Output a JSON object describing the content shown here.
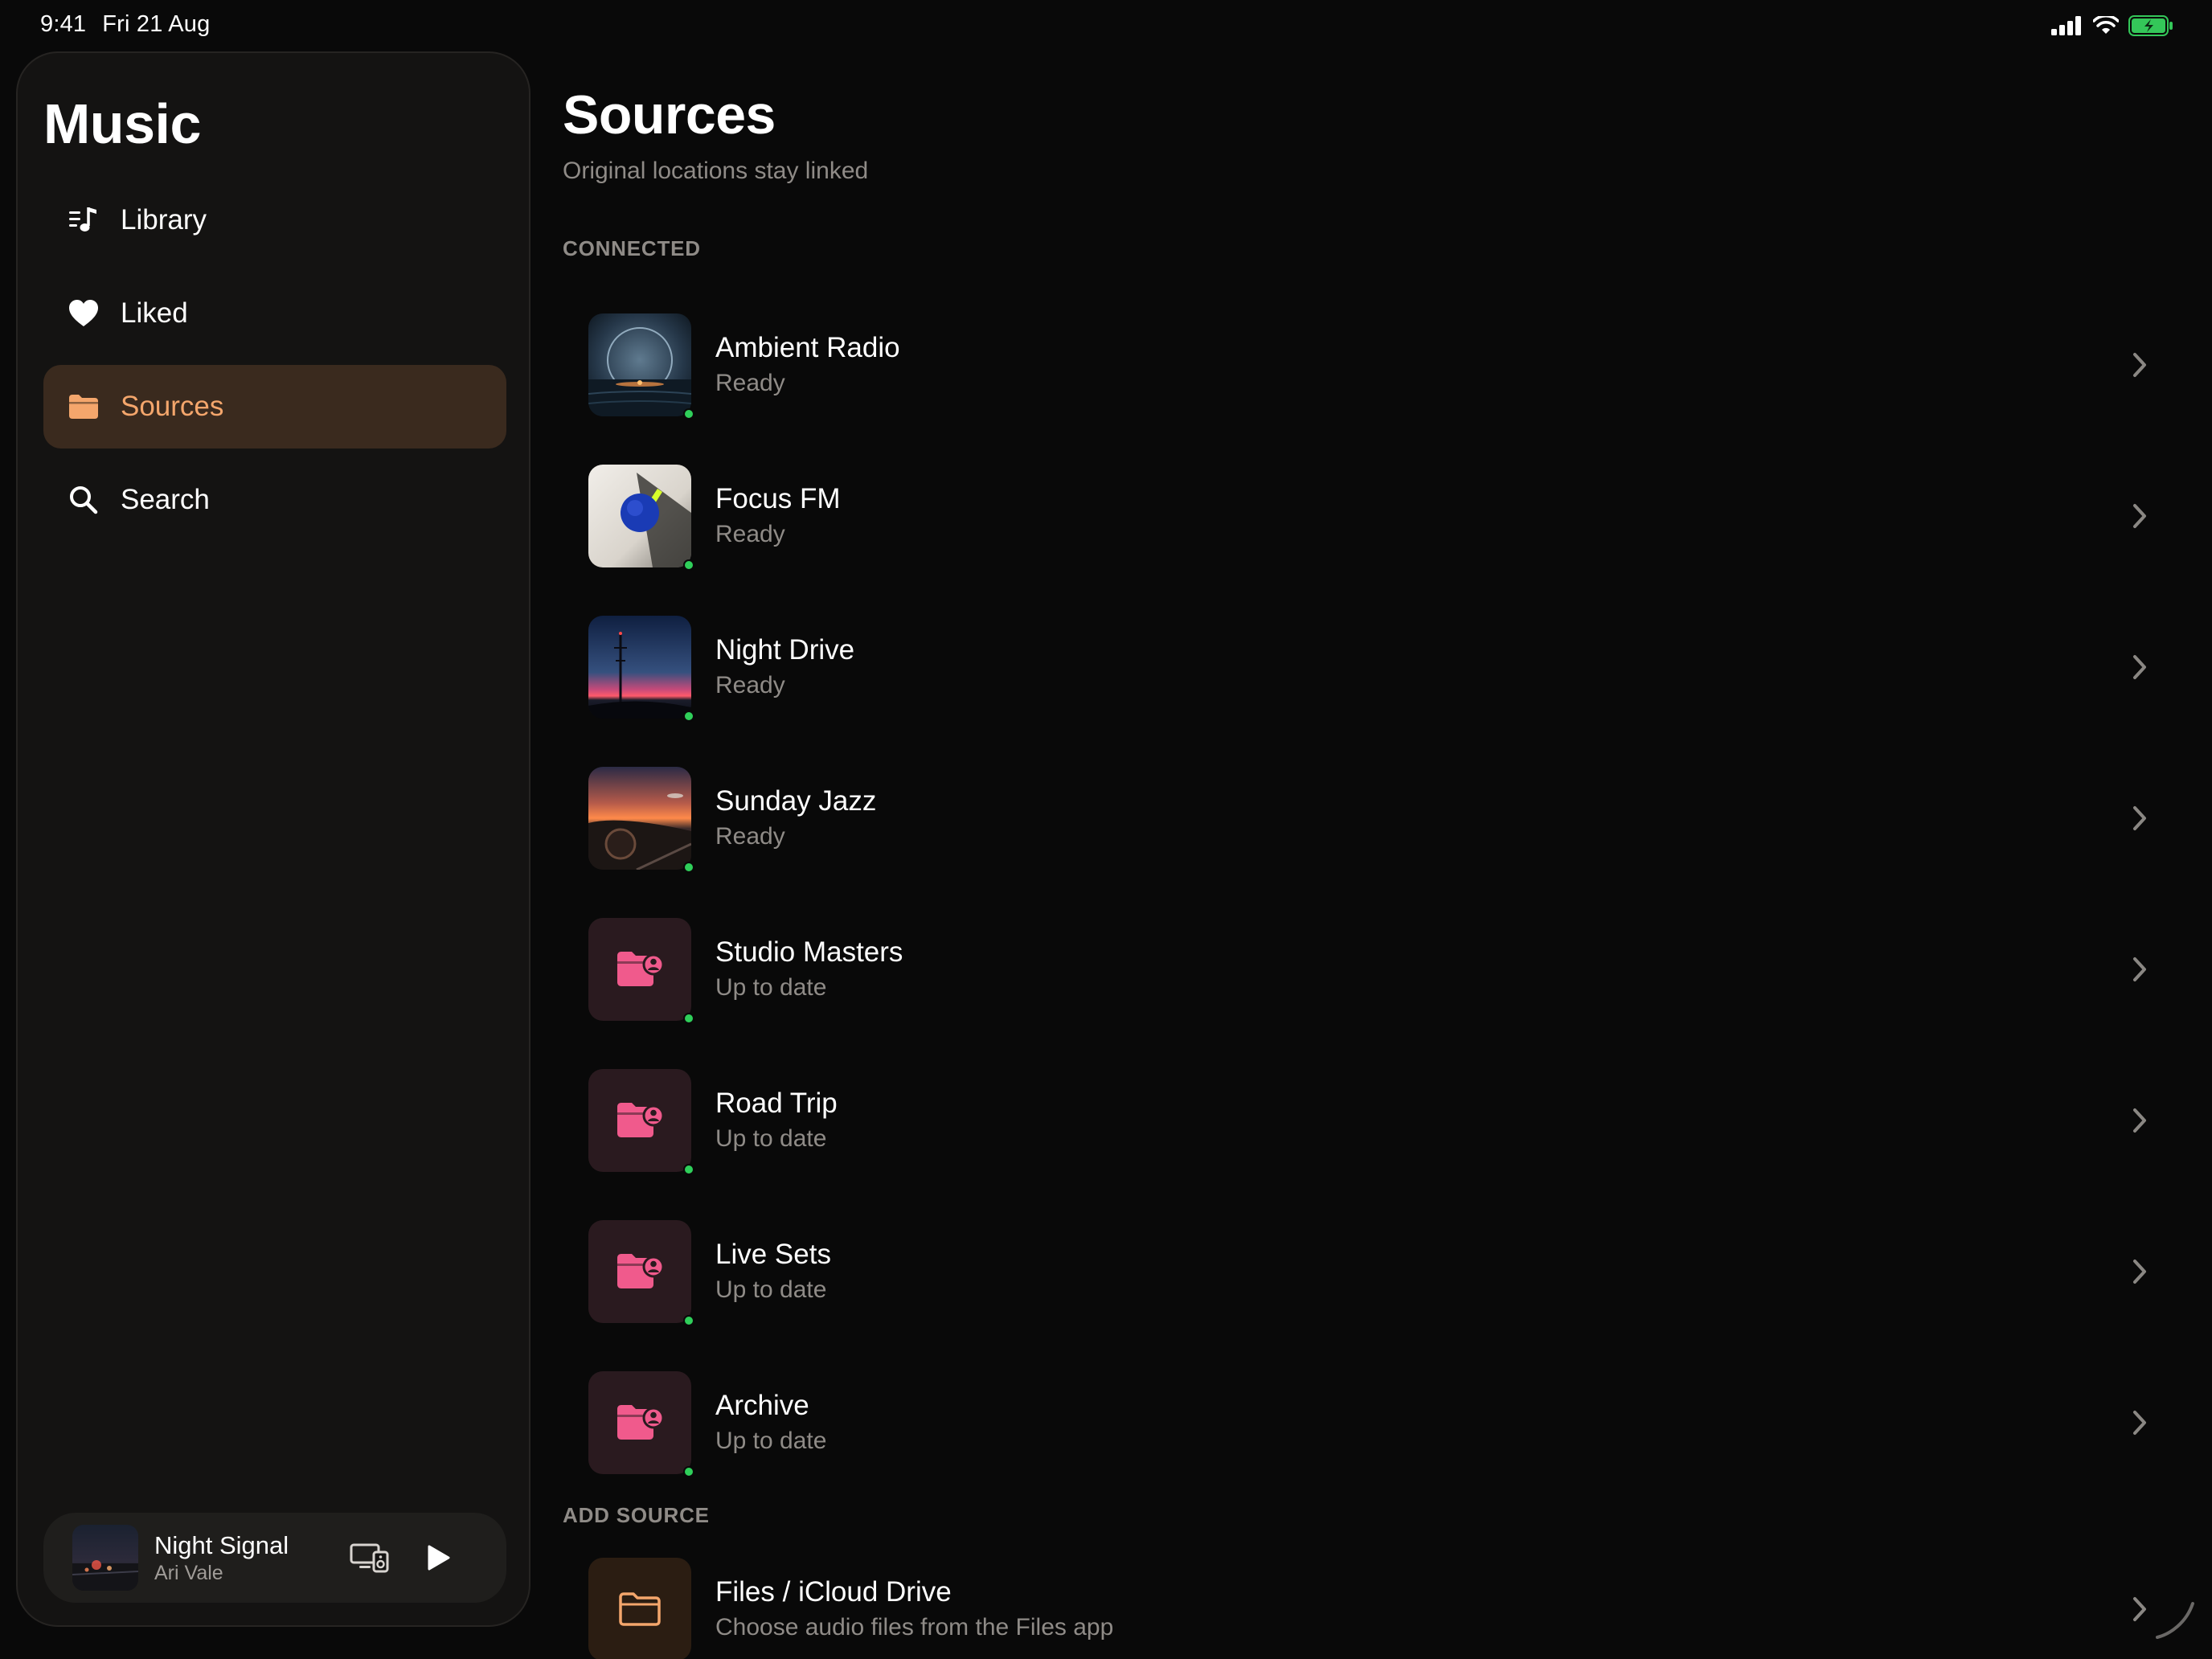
{
  "status_bar": {
    "time": "9:41",
    "date": "Fri 21 Aug",
    "icons": [
      "cellular-signal-icon",
      "wifi-icon",
      "battery-charging-icon"
    ]
  },
  "sidebar": {
    "app_title": "Music",
    "items": [
      {
        "label": "Library",
        "icon": "music-list-icon",
        "active": false
      },
      {
        "label": "Liked",
        "icon": "heart-icon",
        "active": false
      },
      {
        "label": "Sources",
        "icon": "folder-icon",
        "active": true
      },
      {
        "label": "Search",
        "icon": "search-icon",
        "active": false
      }
    ],
    "now_playing": {
      "title": "Night Signal",
      "artist": "Ari Vale",
      "icons": [
        "airplay-devices-icon",
        "play-icon"
      ]
    }
  },
  "main": {
    "title": "Sources",
    "subtitle": "Original locations stay linked",
    "connected_header": "CONNECTED",
    "connected": [
      {
        "title": "Ambient Radio",
        "status": "Ready",
        "artwork": "image"
      },
      {
        "title": "Focus FM",
        "status": "Ready",
        "artwork": "image"
      },
      {
        "title": "Night Drive",
        "status": "Ready",
        "artwork": "image"
      },
      {
        "title": "Sunday Jazz",
        "status": "Ready",
        "artwork": "image"
      },
      {
        "title": "Studio Masters",
        "status": "Up to date",
        "artwork": "shared-folder-icon"
      },
      {
        "title": "Road Trip",
        "status": "Up to date",
        "artwork": "shared-folder-icon"
      },
      {
        "title": "Live Sets",
        "status": "Up to date",
        "artwork": "shared-folder-icon"
      },
      {
        "title": "Archive",
        "status": "Up to date",
        "artwork": "shared-folder-icon"
      }
    ],
    "add_header": "ADD SOURCE",
    "add_sources": [
      {
        "title": "Files / iCloud Drive",
        "subtitle": "Choose audio files from the Files app",
        "icon": "folder-outline-icon"
      }
    ]
  },
  "colors": {
    "background": "#090909",
    "sidebar": "#141312",
    "accent": "#f4a66c",
    "active_bg": "#3a2a1e",
    "folder_icon": "#f05a8c",
    "status_dot": "#2fcf5a",
    "battery": "#34c759"
  }
}
